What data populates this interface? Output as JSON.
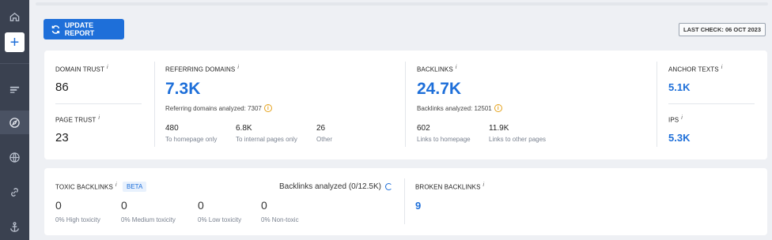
{
  "header": {
    "update_label": "UPDATE REPORT",
    "last_check": "LAST CHECK: 06 OCT 2023"
  },
  "sidebar": {
    "add_label": "+",
    "items": [
      "home-icon",
      "add-icon",
      "list-icon",
      "compass-icon",
      "globe-icon",
      "link-icon",
      "anchor-icon"
    ]
  },
  "domain_trust": {
    "label": "DOMAIN TRUST",
    "info": "i",
    "value": "86"
  },
  "page_trust": {
    "label": "PAGE TRUST",
    "info": "i",
    "value": "23"
  },
  "referring_domains": {
    "label": "REFERRING DOMAINS",
    "info": "i",
    "value": "7.3K",
    "analyzed": "Referring domains analyzed: 7307",
    "stats": [
      {
        "value": "480",
        "label": "To homepage only"
      },
      {
        "value": "6.8K",
        "label": "To internal pages only"
      },
      {
        "value": "26",
        "label": "Other"
      }
    ]
  },
  "backlinks": {
    "label": "BACKLINKS",
    "info": "i",
    "value": "24.7K",
    "analyzed": "Backlinks analyzed: 12501",
    "stats": [
      {
        "value": "602",
        "label": "Links to homepage"
      },
      {
        "value": "11.9K",
        "label": "Links to other pages"
      }
    ]
  },
  "anchor_texts": {
    "label": "ANCHOR TEXTS",
    "info": "i",
    "value": "5.1K"
  },
  "ips": {
    "label": "IPS",
    "info": "i",
    "value": "5.3K"
  },
  "toxic": {
    "label": "TOXIC BACKLINKS",
    "info": "i",
    "beta": "BETA",
    "analyzed": "Backlinks analyzed (0/12.5K)",
    "items": [
      {
        "value": "0",
        "label": "0% High toxicity"
      },
      {
        "value": "0",
        "label": "0% Medium toxicity"
      },
      {
        "value": "0",
        "label": "0% Low toxicity"
      },
      {
        "value": "0",
        "label": "0% Non-toxic"
      }
    ]
  },
  "broken": {
    "label": "BROKEN BACKLINKS",
    "info": "i",
    "value": "9"
  },
  "colors": {
    "accent": "#1e6fd9",
    "sidebar": "#3a4150",
    "warning": "#e5a21b"
  }
}
